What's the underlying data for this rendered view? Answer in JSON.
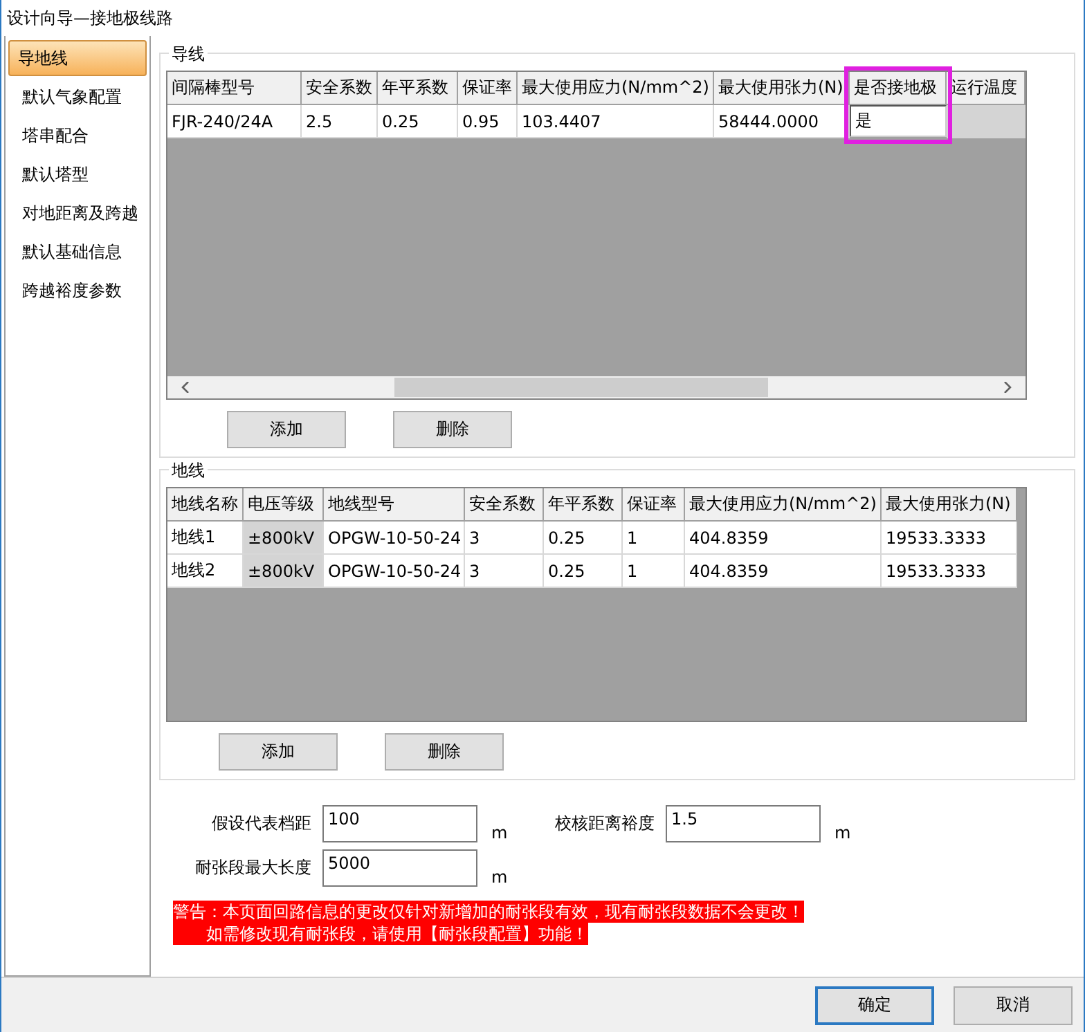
{
  "window": {
    "title": "设计向导—接地极线路"
  },
  "sidebar": {
    "items": [
      {
        "label": "导地线",
        "selected": true
      },
      {
        "label": "默认气象配置",
        "selected": false
      },
      {
        "label": "塔串配合",
        "selected": false
      },
      {
        "label": "默认塔型",
        "selected": false
      },
      {
        "label": "对地距离及跨越",
        "selected": false
      },
      {
        "label": "默认基础信息",
        "selected": false
      },
      {
        "label": "跨越裕度参数",
        "selected": false
      }
    ]
  },
  "conductor": {
    "title": "导线",
    "columns": [
      {
        "label": "间隔棒型号",
        "highlighted": false
      },
      {
        "label": "安全系数",
        "highlighted": false
      },
      {
        "label": "年平系数",
        "highlighted": false
      },
      {
        "label": "保证率",
        "highlighted": false
      },
      {
        "label": "最大使用应力(N/mm^2)",
        "highlighted": false
      },
      {
        "label": "最大使用张力(N)",
        "highlighted": false
      },
      {
        "label": "是否接地极",
        "highlighted": true
      },
      {
        "label": "运行温度",
        "highlighted": false
      }
    ],
    "rows": [
      [
        "FJR-240/24A",
        "2.5",
        "0.25",
        "0.95",
        "103.4407",
        "58444.0000",
        "是",
        null
      ]
    ],
    "buttons": [
      "添加",
      "删除"
    ]
  },
  "ground_wire": {
    "title": "地线",
    "columns": [
      {
        "label": "地线名称",
        "readonly": false
      },
      {
        "label": "电压等级",
        "readonly": true
      },
      {
        "label": "地线型号",
        "readonly": false
      },
      {
        "label": "安全系数",
        "readonly": false
      },
      {
        "label": "年平系数",
        "readonly": false
      },
      {
        "label": "保证率",
        "readonly": false
      },
      {
        "label": "最大使用应力(N/mm^2)",
        "readonly": false
      },
      {
        "label": "最大使用张力(N)",
        "readonly": false
      }
    ],
    "rows": [
      [
        "地线1",
        "±800kV",
        "OPGW-10-50-24",
        "3",
        "0.25",
        "1",
        "404.8359",
        "19533.3333"
      ],
      [
        "地线2",
        "±800kV",
        "OPGW-10-50-24",
        "3",
        "0.25",
        "1",
        "404.8359",
        "19533.3333"
      ]
    ],
    "buttons": [
      "添加",
      "删除"
    ]
  },
  "fields": {
    "span": {
      "label": "假设代表档距",
      "value": "100",
      "unit": "m"
    },
    "margin": {
      "label": "校核距离裕度",
      "value": "1.5",
      "unit": "m"
    },
    "max_length": {
      "label": "耐张段最大长度",
      "value": "5000",
      "unit": "m"
    }
  },
  "warning": [
    "警告：本页面回路信息的更改仅针对新增加的耐张段有效，现有耐张段数据不会更改！",
    "如需修改现有耐张段，请使用【耐张段配置】功能！"
  ],
  "buttons": [
    "确定",
    "取消"
  ]
}
